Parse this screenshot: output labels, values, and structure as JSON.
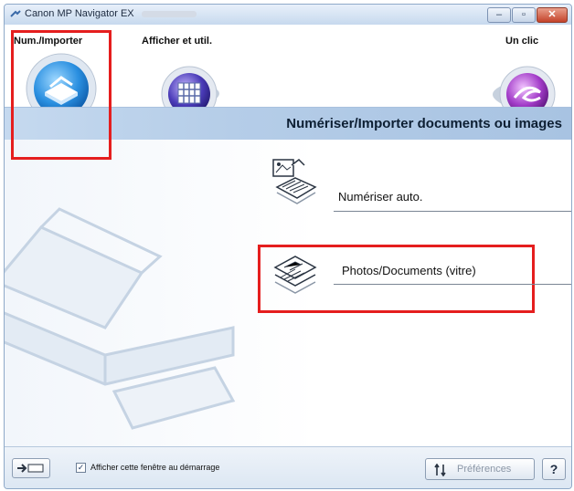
{
  "window": {
    "title": "Canon MP Navigator EX"
  },
  "modes": [
    {
      "label": "Num./Importer",
      "icon": "scanner-icon"
    },
    {
      "label": "Afficher et util.",
      "icon": "view-use-icon"
    },
    {
      "label": "Un clic",
      "icon": "one-click-icon"
    }
  ],
  "panel": {
    "heading": "Numériser/Importer documents ou images",
    "items": [
      {
        "label": "Numériser auto.",
        "icon": "auto-scan-icon"
      },
      {
        "label": "Photos/Documents (vitre)",
        "icon": "photos-documents-icon"
      }
    ]
  },
  "statusbar": {
    "checkbox_label": "Afficher cette fenêtre au démarrage",
    "checkbox_checked": true,
    "checkbox_mark": "✓",
    "preferences_label": "Préférences",
    "help_label": "?"
  },
  "colors": {
    "highlight": "#e51e1e"
  }
}
